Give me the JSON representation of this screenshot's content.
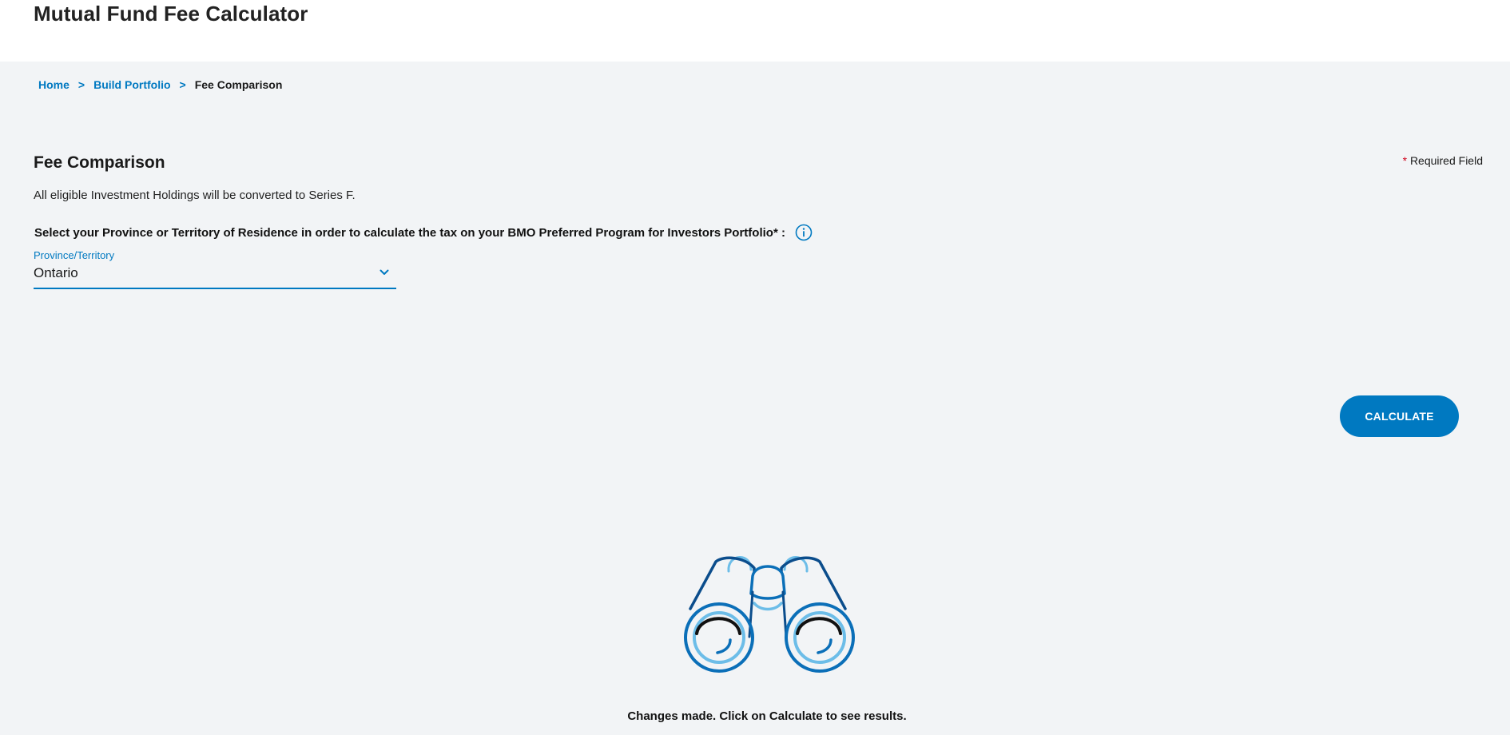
{
  "header": {
    "title": "Mutual Fund Fee Calculator"
  },
  "breadcrumb": {
    "items": [
      "Home",
      "Build Portfolio"
    ],
    "separator": ">",
    "current": "Fee Comparison"
  },
  "main": {
    "section_title": "Fee Comparison",
    "required_marker": "*",
    "required_label": "Required Field",
    "conversion_note": "All eligible Investment Holdings will be converted to Series F.",
    "province_prompt": "Select your Province or Territory of Residence in order to calculate the tax on your BMO Preferred Program for Investors Portfolio* :",
    "province_field": {
      "label": "Province/Territory",
      "value": "Ontario"
    },
    "calculate_label": "CALCULATE",
    "status_message": "Changes made. Click on Calculate to see results."
  },
  "icons": {
    "info": "info-icon",
    "dropdown": "chevron-down-icon",
    "illustration": "binoculars-icon"
  },
  "colors": {
    "accent": "#0079c1",
    "background": "#f2f4f6",
    "header_bg": "#ffffff",
    "required_star": "#d0021b",
    "illustration_dark": "#0b4d8c",
    "illustration_light": "#6cbde8"
  }
}
